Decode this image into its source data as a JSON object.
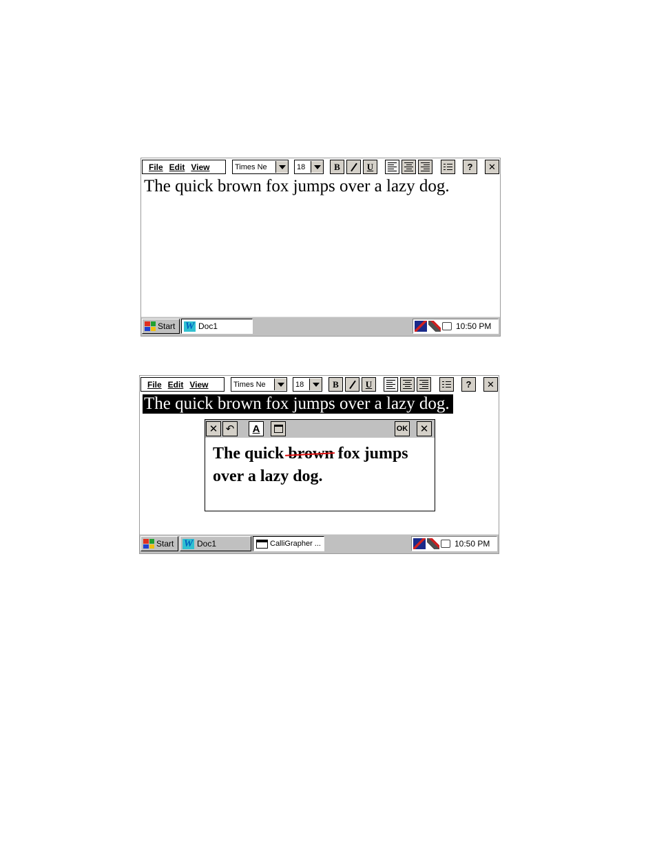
{
  "menus": [
    "File",
    "Edit",
    "View"
  ],
  "font_combo": "Times Ne",
  "size_combo": "18",
  "toolbar": {
    "bold": "B",
    "italic": "I",
    "underline": "U",
    "help": "?",
    "close": "✕"
  },
  "document": {
    "text": "The quick brown fox jumps over a lazy dog."
  },
  "taskbar": {
    "start_label": "Start",
    "doc_label": "Doc1",
    "calligrapher_label": "CalliGrapher ...",
    "clock": "10:50 PM"
  },
  "calligrapher": {
    "ok_label": "OK",
    "line1_before": "The quick ",
    "struck_word": "brown",
    "line1_after": " fox jumps",
    "line2": "over a lazy dog.",
    "accent": "#e01010"
  }
}
